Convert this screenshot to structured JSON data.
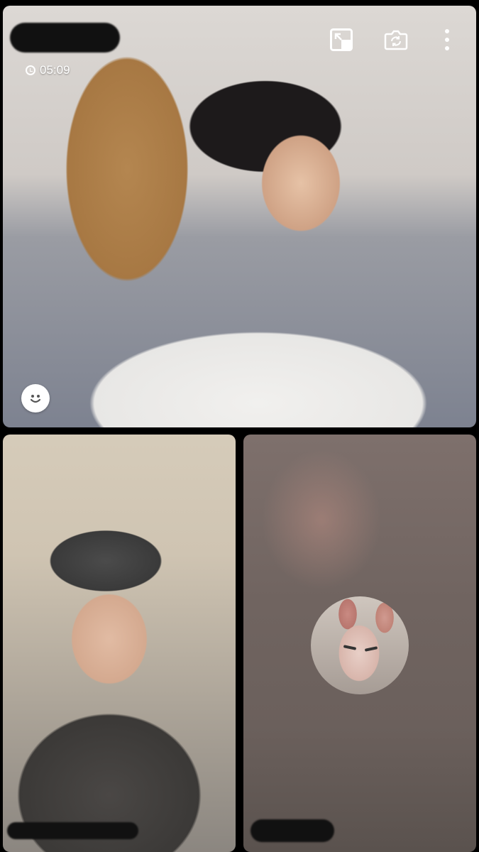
{
  "call": {
    "timer": "05:09",
    "participants": [
      {
        "id": "main",
        "name_redacted": true
      },
      {
        "id": "bottom-left",
        "name_redacted": true
      },
      {
        "id": "bottom-right",
        "name_redacted": true,
        "camera_off": true,
        "avatar": "cat-avatar"
      }
    ]
  },
  "controls": {
    "minimize_icon": "minimize-window-icon",
    "switch_camera_icon": "switch-camera-icon",
    "more_icon": "more-vertical-icon",
    "reaction_icon": "smiley-icon"
  },
  "colors": {
    "background": "#000000",
    "overlay_text": "#ffffff"
  }
}
